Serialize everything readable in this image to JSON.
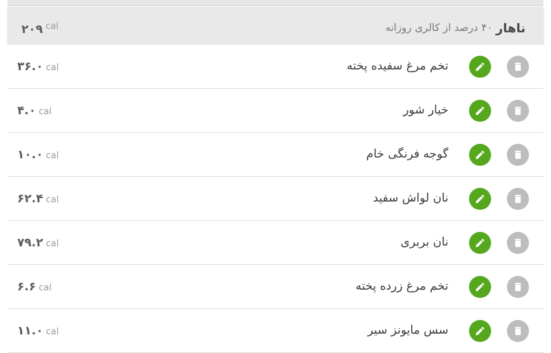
{
  "meal": {
    "title": "ناهار",
    "subtitle": "۴۰ درصد از کالری روزانه",
    "total_value": "۲۰۹",
    "total_unit": "cal"
  },
  "colors": {
    "edit_button": "#55a81e",
    "delete_button": "#bdbdbd",
    "header_bg": "#e9e9e9"
  },
  "icons": {
    "edit": "pencil-icon",
    "delete": "trash-icon"
  },
  "items": [
    {
      "name": "تخم مرغ سفیده پخته",
      "calories": "۳۶.۰",
      "unit": "cal"
    },
    {
      "name": "خیار شور",
      "calories": "۴.۰",
      "unit": "cal"
    },
    {
      "name": "گوجه فرنگی خام",
      "calories": "۱۰.۰",
      "unit": "cal"
    },
    {
      "name": "نان لواش سفید",
      "calories": "۶۲.۴",
      "unit": "cal"
    },
    {
      "name": "نان بربری",
      "calories": "۷۹.۲",
      "unit": "cal"
    },
    {
      "name": "تخم مرغ زرده پخته",
      "calories": "۶.۶",
      "unit": "cal"
    },
    {
      "name": "سس مایونز سیر",
      "calories": "۱۱.۰",
      "unit": "cal"
    }
  ]
}
